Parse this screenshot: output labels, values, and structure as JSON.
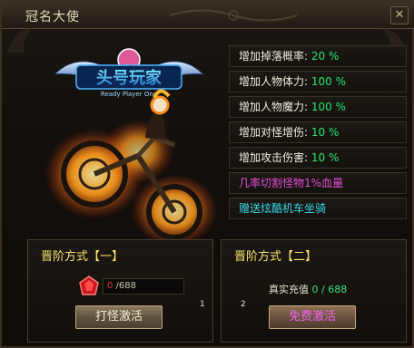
{
  "window": {
    "title": "冠名大使",
    "close_label": "✕"
  },
  "art": {
    "logo_text_main": "头号玩家",
    "logo_text_sub": "Ready Player One"
  },
  "stats": [
    {
      "label": "增加掉落概率: ",
      "value": "20 %"
    },
    {
      "label": "增加人物体力: ",
      "value": "100 %"
    },
    {
      "label": "增加人物魔力: ",
      "value": "100 %"
    },
    {
      "label": "增加对怪增伤: ",
      "value": "10 %"
    },
    {
      "label": "增加攻击伤害: ",
      "value": "10 %"
    },
    {
      "label": "几率切割怪物1%血量",
      "value": ""
    },
    {
      "label": "赠送炫酷机车坐骑",
      "value": ""
    }
  ],
  "method1": {
    "title": "晋阶方式【一】",
    "progress_current": "0",
    "progress_total": " /688",
    "button_label": "打怪激活",
    "index": "1"
  },
  "method2": {
    "title": "晋阶方式【二】",
    "recharge_label": "真实充值 ",
    "recharge_value": "0 / 688",
    "button_label": "免费激活",
    "index": "2"
  },
  "colors": {
    "accent_green": "#28e36e",
    "pink": "#e24ed8",
    "cyan": "#38d7ea",
    "gold": "#f7e36a"
  }
}
